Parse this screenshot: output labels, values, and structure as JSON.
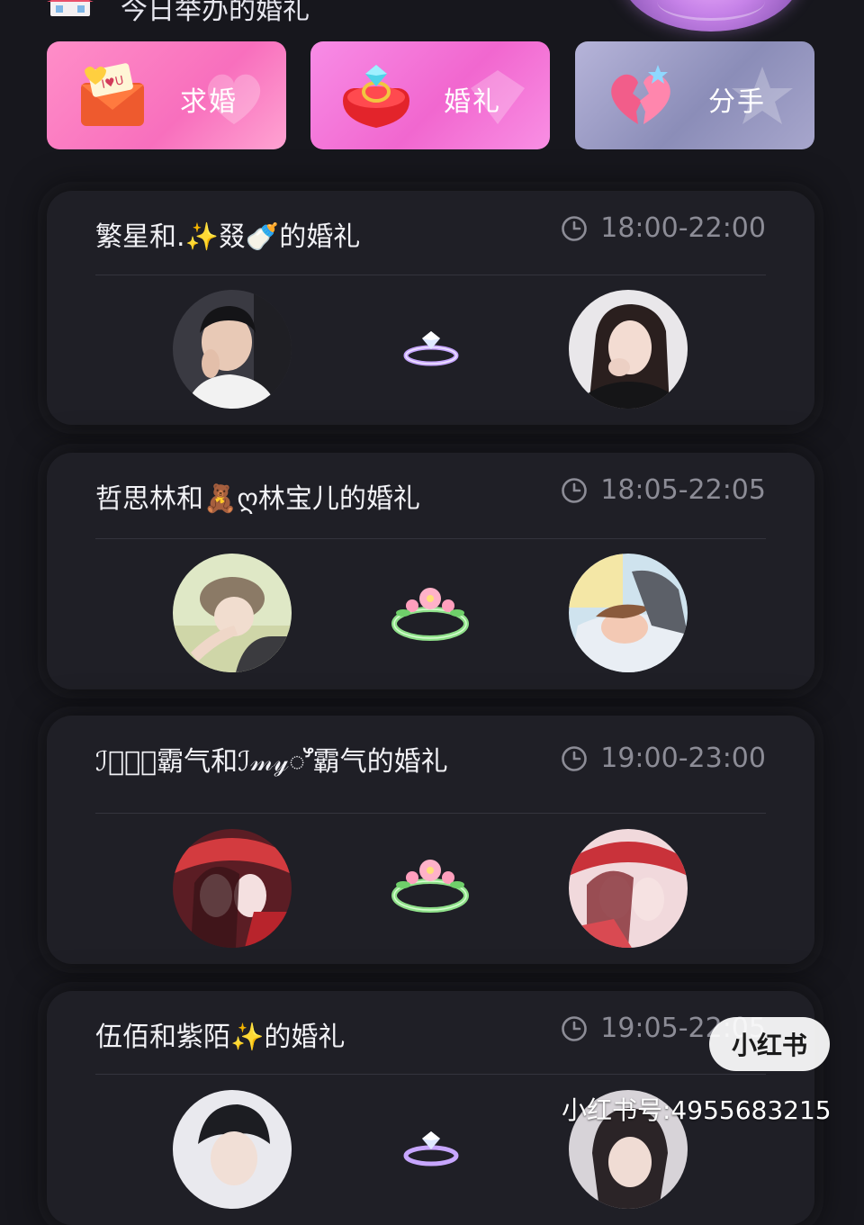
{
  "header": {
    "title": "今日举办的婚礼",
    "home_icon": "house-icon"
  },
  "actions": [
    {
      "label": "求婚",
      "icon": "love-letter-icon",
      "color": "#f86fbd"
    },
    {
      "label": "婚礼",
      "icon": "ring-box-icon",
      "color": "#f167cf"
    },
    {
      "label": "分手",
      "icon": "broken-heart-icon",
      "color": "#8b8db8"
    }
  ],
  "weddings": [
    {
      "title": "繁星和.✨叕🍼的婚礼",
      "time": "18:00-22:00",
      "ring": "diamond-ring-icon"
    },
    {
      "title": "哲思林和🧸ღ林宝儿的婚礼",
      "time": "18:05-22:05",
      "ring": "flower-ring-icon"
    },
    {
      "title": "ℐ𝓂𝓎ꯧ霸气和ℐ𝓂𝓎ꯧ霸气的婚礼",
      "time": "19:00-23:00",
      "ring": "flower-ring-icon"
    },
    {
      "title": "伍佰和紫陌✨的婚礼",
      "time": "19:05-22:05",
      "ring": "diamond-ring-icon"
    }
  ],
  "watermark": {
    "brand": "小红书",
    "id_text": "小红书号:4955683215"
  }
}
